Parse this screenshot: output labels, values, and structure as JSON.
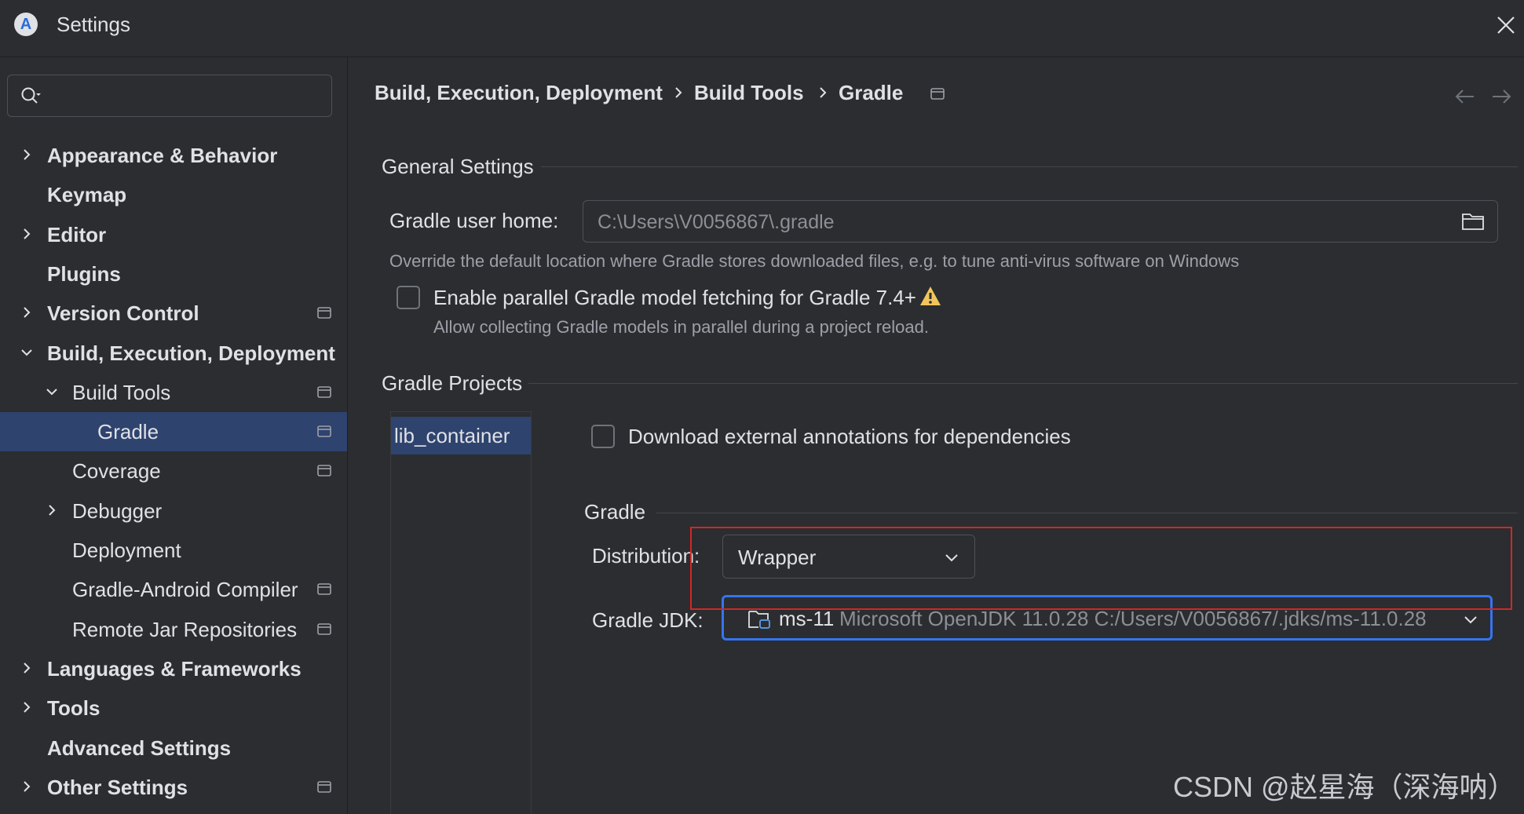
{
  "window": {
    "title": "Settings"
  },
  "search": {
    "placeholder": ""
  },
  "sidebar": {
    "items": [
      {
        "label": "Appearance & Behavior",
        "bold": true,
        "level": 0,
        "chevron": "right",
        "pin": false
      },
      {
        "label": "Keymap",
        "bold": true,
        "level": 0,
        "chevron": "none",
        "pin": false
      },
      {
        "label": "Editor",
        "bold": true,
        "level": 0,
        "chevron": "right",
        "pin": false
      },
      {
        "label": "Plugins",
        "bold": true,
        "level": 0,
        "chevron": "none",
        "pin": false
      },
      {
        "label": "Version Control",
        "bold": true,
        "level": 0,
        "chevron": "right",
        "pin": true
      },
      {
        "label": "Build, Execution, Deployment",
        "bold": true,
        "level": 0,
        "chevron": "down",
        "pin": false
      },
      {
        "label": "Build Tools",
        "bold": false,
        "level": 1,
        "chevron": "down",
        "pin": true
      },
      {
        "label": "Gradle",
        "bold": false,
        "level": 2,
        "chevron": "none",
        "pin": true,
        "selected": true
      },
      {
        "label": "Coverage",
        "bold": false,
        "level": 1,
        "chevron": "none",
        "pin": true
      },
      {
        "label": "Debugger",
        "bold": false,
        "level": 1,
        "chevron": "right",
        "pin": false
      },
      {
        "label": "Deployment",
        "bold": false,
        "level": 1,
        "chevron": "none",
        "pin": false
      },
      {
        "label": "Gradle-Android Compiler",
        "bold": false,
        "level": 1,
        "chevron": "none",
        "pin": true
      },
      {
        "label": "Remote Jar Repositories",
        "bold": false,
        "level": 1,
        "chevron": "none",
        "pin": true
      },
      {
        "label": "Languages & Frameworks",
        "bold": true,
        "level": 0,
        "chevron": "right",
        "pin": false
      },
      {
        "label": "Tools",
        "bold": true,
        "level": 0,
        "chevron": "right",
        "pin": false
      },
      {
        "label": "Advanced Settings",
        "bold": true,
        "level": 0,
        "chevron": "none",
        "pin": false
      },
      {
        "label": "Other Settings",
        "bold": true,
        "level": 0,
        "chevron": "right",
        "pin": true
      }
    ]
  },
  "breadcrumb": [
    "Build, Execution, Deployment",
    "Build Tools",
    "Gradle"
  ],
  "general": {
    "title": "General Settings",
    "user_home_label": "Gradle user home:",
    "user_home_value": "C:\\Users\\V0056867\\.gradle",
    "user_home_hint": "Override the default location where Gradle stores downloaded files, e.g. to tune anti-virus software on Windows",
    "parallel_label": "Enable parallel Gradle model fetching for Gradle 7.4+",
    "parallel_hint": "Allow collecting Gradle models in parallel during a project reload.",
    "parallel_checked": false
  },
  "projects": {
    "title": "Gradle Projects",
    "items": [
      "lib_container"
    ],
    "download_annotations_label": "Download external annotations for dependencies",
    "download_annotations_checked": false
  },
  "gradle": {
    "title": "Gradle",
    "distribution_label": "Distribution:",
    "distribution_value": "Wrapper",
    "jdk_label": "Gradle JDK:",
    "jdk_name": "ms-11",
    "jdk_detail": "Microsoft OpenJDK 11.0.28 C:/Users/V0056867/.jdks/ms-11.0.28"
  },
  "watermark": "CSDN @赵星海（深海呐）",
  "colors": {
    "background": "#2b2d30",
    "selection": "#2e436e",
    "focus_border": "#3574f0",
    "highlight_box": "#d42626",
    "warning": "#f2c55c"
  },
  "icons": {
    "logo": "android-studio-logo-icon",
    "close": "close-icon",
    "search": "search-icon",
    "pin": "pin-icon",
    "back": "arrow-left-icon",
    "forward": "arrow-right-icon",
    "folder": "folder-icon",
    "warning": "warning-icon",
    "jdk": "jdk-folder-icon",
    "dropdown": "chevron-down-icon"
  }
}
